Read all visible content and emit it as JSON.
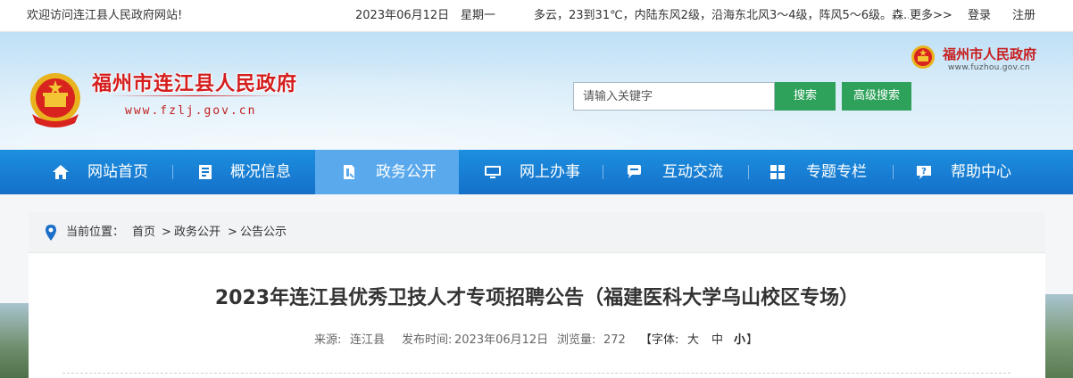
{
  "topbar": {
    "welcome": "欢迎访问连江县人民政府网站!",
    "date": "2023年06月12日",
    "weekday": "星期一",
    "weather": "多云，23到31℃，内陆东风2级，沿海东北风3～4级，阵风5～6级。森...",
    "more": "更多>>",
    "login": "登录",
    "register": "注册"
  },
  "header": {
    "site_title": "福州市连江县人民政府",
    "site_url": "www.fzlj.gov.cn",
    "city_name": "福州市人民政府",
    "city_url": "www.fuzhou.gov.cn",
    "search": {
      "placeholder": "请输入关键字",
      "search_label": "搜索",
      "advanced_label": "高级搜索"
    }
  },
  "nav": {
    "items": [
      {
        "label": "网站首页",
        "icon": "home-icon"
      },
      {
        "label": "概况信息",
        "icon": "info-book-icon"
      },
      {
        "label": "政务公开",
        "icon": "document-icon"
      },
      {
        "label": "网上办事",
        "icon": "monitor-icon"
      },
      {
        "label": "互动交流",
        "icon": "chat-icon"
      },
      {
        "label": "专题专栏",
        "icon": "grid-icon"
      },
      {
        "label": "帮助中心",
        "icon": "help-icon"
      }
    ],
    "active_index": 2
  },
  "breadcrumb": {
    "prefix": "当前位置：",
    "items": [
      "首页",
      "政务公开",
      "公告公示"
    ],
    "separator": ">"
  },
  "article": {
    "title": "2023年连江县优秀卫技人才专项招聘公告（福建医科大学乌山校区专场）",
    "source_label": "来源:",
    "source": "连江县",
    "publish_label": "发布时间:",
    "publish_time": "2023年06月12日",
    "views_label": "浏览量:",
    "views": "272",
    "font_size_label": "【字体:",
    "font_large": "大",
    "font_medium": "中",
    "font_small": "小",
    "font_close": "】"
  },
  "colors": {
    "nav_bg": "#1470c9",
    "nav_active": "#5aa9ec",
    "brand_red": "#d41d1d",
    "search_green": "#2ea25a"
  }
}
